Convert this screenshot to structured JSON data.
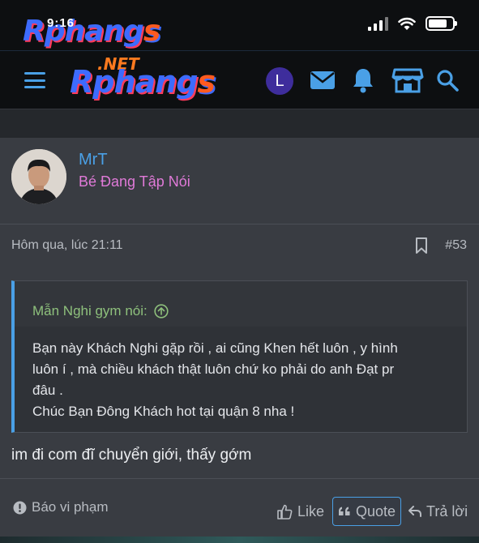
{
  "status_bar": {
    "time": "9:16",
    "watermark_brand": "Rphang",
    "watermark_accent": "s"
  },
  "nav": {
    "logo_net": ".NET",
    "logo_brand": "Rphang",
    "logo_accent": "s",
    "avatar_letter": "L",
    "icons": [
      "menu-icon",
      "mail-icon",
      "bell-icon",
      "store-icon",
      "search-icon"
    ]
  },
  "post": {
    "username": "MrT",
    "user_title": "Bé Đang Tập Nói",
    "timestamp": "Hôm qua, lúc 21:11",
    "post_number": "#53",
    "quote": {
      "author": "Mẫn Nghi gym nói:",
      "lines": [
        "Bạn này Khách Nghi gặp rồi , ai cũng Khen hết luôn , y hình",
        "luôn í , mà chiều khách thật luôn chứ ko phải do anh Đạt pr",
        "đâu .",
        "Chúc Bạn Đông Khách hot tại quận 8 nha !"
      ]
    },
    "message": "im đi com đĩ chuyển giới, thấy gớm",
    "actions": {
      "report": "Báo vi phạm",
      "like": "Like",
      "quote": "Quote",
      "reply": "Trả lời"
    }
  },
  "colors": {
    "accent": "#4aa0e6",
    "user_title": "#e07ad8",
    "quote_author": "#8ec07c",
    "avatar_bg": "#3e2d9c"
  }
}
